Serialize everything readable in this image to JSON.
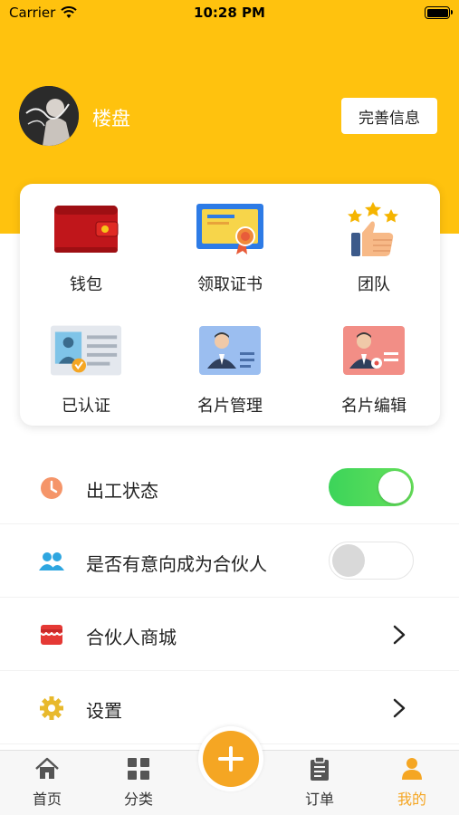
{
  "status_bar": {
    "carrier": "Carrier",
    "time": "10:28 PM"
  },
  "profile": {
    "name": "楼盘",
    "complete_button": "完善信息"
  },
  "grid": [
    {
      "label": "钱包",
      "icon": "wallet-icon"
    },
    {
      "label": "领取证书",
      "icon": "certificate-icon"
    },
    {
      "label": "团队",
      "icon": "team-thumbs-up-icon"
    },
    {
      "label": "已认证",
      "icon": "verified-id-icon"
    },
    {
      "label": "名片管理",
      "icon": "business-card-icon"
    },
    {
      "label": "名片编辑",
      "icon": "business-card-edit-icon"
    }
  ],
  "settings": {
    "work_status": {
      "label": "出工状态",
      "icon": "clock-icon",
      "enabled": true
    },
    "partner_intent": {
      "label": "是否有意向成为合伙人",
      "icon": "people-icon",
      "enabled": false
    },
    "partner_mall": {
      "label": "合伙人商城",
      "icon": "store-icon"
    },
    "settings": {
      "label": "设置",
      "icon": "gear-icon"
    }
  },
  "tabbar": {
    "items": [
      {
        "label": "首页",
        "icon": "home-icon",
        "active": false
      },
      {
        "label": "分类",
        "icon": "grid-icon",
        "active": false
      },
      {
        "label": "",
        "icon": "plus-icon",
        "active": false
      },
      {
        "label": "订单",
        "icon": "clipboard-icon",
        "active": false
      },
      {
        "label": "我的",
        "icon": "person-icon",
        "active": true
      }
    ]
  },
  "colors": {
    "header": "#FFC20E",
    "accent": "#F5A623",
    "toggle_on": "#4CD964"
  }
}
